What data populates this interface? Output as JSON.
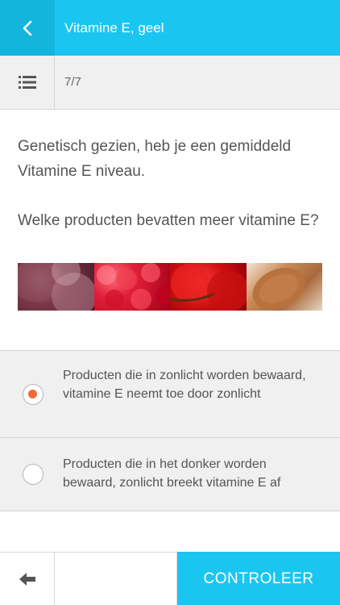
{
  "header": {
    "title": "Vitamine E, geel",
    "back_icon": "chevron-left-icon"
  },
  "subbar": {
    "list_icon": "list-icon",
    "progress": "7/7"
  },
  "question": {
    "statement": "Genetisch gezien, heb je een gemiddeld Vitamine E niveau.",
    "prompt": "Welke producten bevatten meer vitamine E?",
    "images": [
      "grapes",
      "raspberries",
      "cherries",
      "almonds"
    ]
  },
  "options": [
    {
      "text": "Producten die in zonlicht worden bewaard, vitamine E neemt toe door zonlicht",
      "selected": true
    },
    {
      "text": "Producten die in het donker worden bewaard, zonlicht breekt vitamine E af",
      "selected": false
    }
  ],
  "footer": {
    "back_icon": "arrow-left-icon",
    "check_label": "CONTROLEER"
  },
  "colors": {
    "accent": "#1ac6ef",
    "accent_dark": "#14b5dd",
    "radio_selected": "#f2683a",
    "option_bg": "#f0f0f0",
    "text": "#555555"
  }
}
